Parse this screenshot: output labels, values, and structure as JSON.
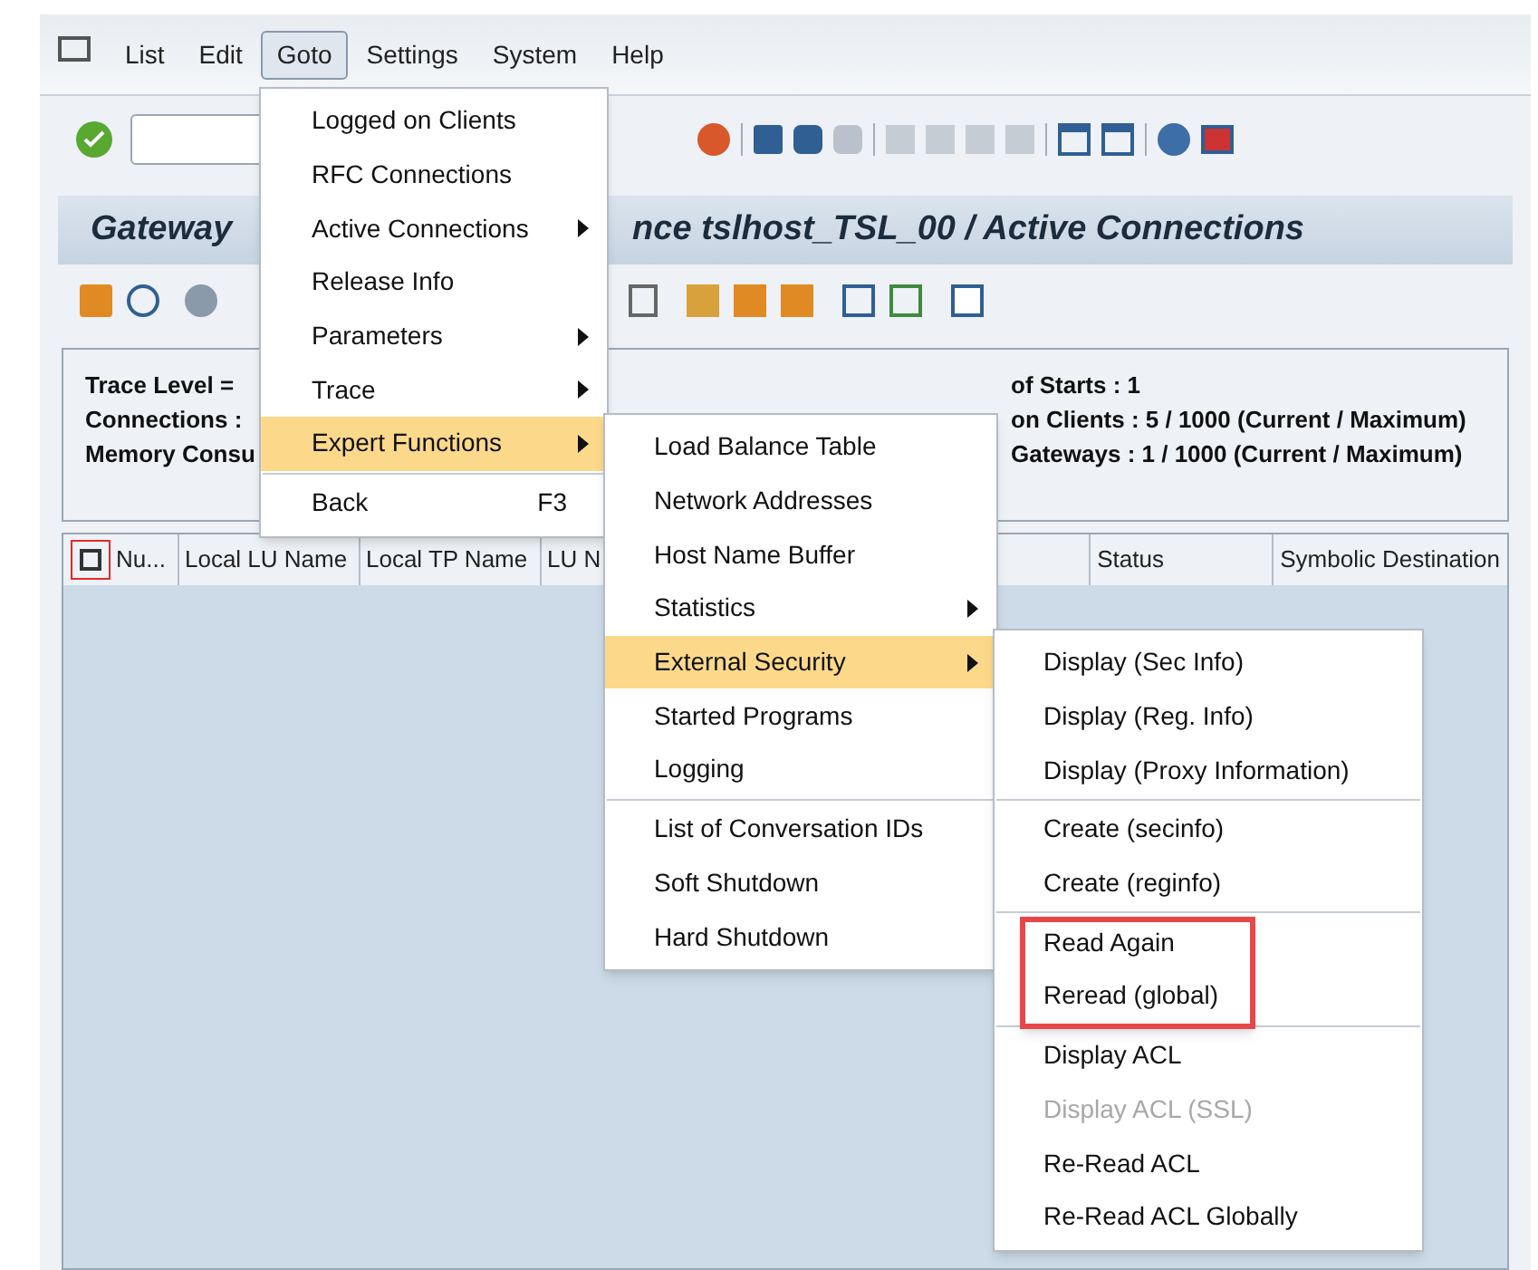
{
  "menu_bar": [
    {
      "label": "List",
      "selected": false
    },
    {
      "label": "Edit",
      "selected": false
    },
    {
      "label": "Goto",
      "selected": true
    },
    {
      "label": "Settings",
      "selected": false
    },
    {
      "label": "System",
      "selected": false
    },
    {
      "label": "Help",
      "selected": false
    }
  ],
  "title": {
    "left": "Gateway",
    "right": "nce tslhost_TSL_00 / Active Connections"
  },
  "info": {
    "left": [
      "Trace Level =",
      "Connections :",
      "Memory Consu"
    ],
    "right": [
      "of Starts : 1",
      "on Clients : 5 / 1000 (Current / Maximum)",
      "Gateways : 1 / 1000 (Current / Maximum)"
    ]
  },
  "table": {
    "columns_left": [
      "Nu...",
      "Local LU Name",
      "Local TP Name",
      "LU N"
    ],
    "columns_right": [
      "Status",
      "Symbolic Destination"
    ]
  },
  "goto_menu": [
    [
      {
        "label": "Logged on Clients",
        "submenu": false,
        "selected": false
      },
      {
        "label": "RFC Connections",
        "submenu": false,
        "selected": false
      },
      {
        "label": "Active Connections",
        "submenu": true,
        "selected": false
      },
      {
        "label": "Release Info",
        "submenu": false,
        "selected": false
      },
      {
        "label": "Parameters",
        "submenu": true,
        "selected": false
      },
      {
        "label": "Trace",
        "submenu": true,
        "selected": false
      },
      {
        "label": "Expert Functions",
        "submenu": true,
        "selected": true
      }
    ],
    [
      {
        "label": "Back",
        "submenu": false,
        "selected": false,
        "shortcut": "F3"
      }
    ]
  ],
  "expert_menu": [
    [
      {
        "label": "Load Balance Table",
        "submenu": false,
        "selected": false
      },
      {
        "label": "Network Addresses",
        "submenu": false,
        "selected": false
      },
      {
        "label": "Host Name Buffer",
        "submenu": false,
        "selected": false
      },
      {
        "label": "Statistics",
        "submenu": true,
        "selected": false
      },
      {
        "label": "External Security",
        "submenu": true,
        "selected": true
      },
      {
        "label": "Started Programs",
        "submenu": false,
        "selected": false
      },
      {
        "label": "Logging",
        "submenu": false,
        "selected": false
      }
    ],
    [
      {
        "label": "List of Conversation IDs",
        "submenu": false,
        "selected": false
      },
      {
        "label": "Soft Shutdown",
        "submenu": false,
        "selected": false
      },
      {
        "label": "Hard Shutdown",
        "submenu": false,
        "selected": false
      }
    ]
  ],
  "security_menu": [
    [
      {
        "label": "Display (Sec Info)",
        "disabled": false
      },
      {
        "label": "Display (Reg. Info)",
        "disabled": false
      },
      {
        "label": "Display (Proxy Information)",
        "disabled": false
      }
    ],
    [
      {
        "label": "Create (secinfo)",
        "disabled": false
      },
      {
        "label": "Create (reginfo)",
        "disabled": false
      }
    ],
    [
      {
        "label": "Read Again",
        "disabled": false
      },
      {
        "label": "Reread (global)",
        "disabled": false
      }
    ],
    [
      {
        "label": "Display ACL",
        "disabled": false
      },
      {
        "label": "Display ACL (SSL)",
        "disabled": true
      },
      {
        "label": "Re-Read ACL",
        "disabled": false
      },
      {
        "label": "Re-Read ACL Globally",
        "disabled": false
      }
    ]
  ]
}
